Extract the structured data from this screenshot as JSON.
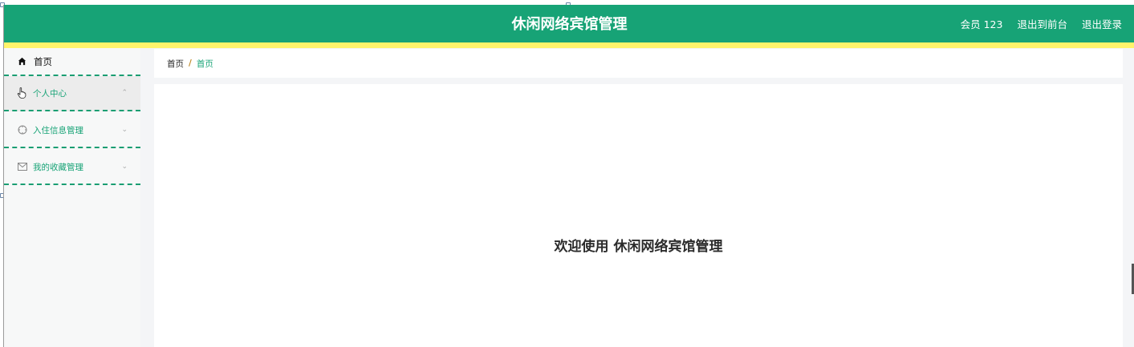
{
  "header": {
    "title": "休闲网络宾馆管理",
    "user_label": "会员 123",
    "to_front_label": "退出到前台",
    "logout_label": "退出登录",
    "bg_color": "#17a376",
    "stripe_color": "#fff46b"
  },
  "sidebar": {
    "home": {
      "label": "首页",
      "icon": "home-icon"
    },
    "items": [
      {
        "label": "个人中心",
        "icon": "hand-pointer-icon",
        "chevron": "⌃",
        "active": true
      },
      {
        "label": "入住信息管理",
        "icon": "target-icon",
        "chevron": "⌄"
      },
      {
        "label": "我的收藏管理",
        "icon": "mail-icon",
        "chevron": "⌄"
      }
    ]
  },
  "breadcrumb": {
    "home": "首页",
    "separator": "/",
    "current": "首页"
  },
  "main": {
    "welcome": "欢迎使用 休闲网络宾馆管理"
  }
}
